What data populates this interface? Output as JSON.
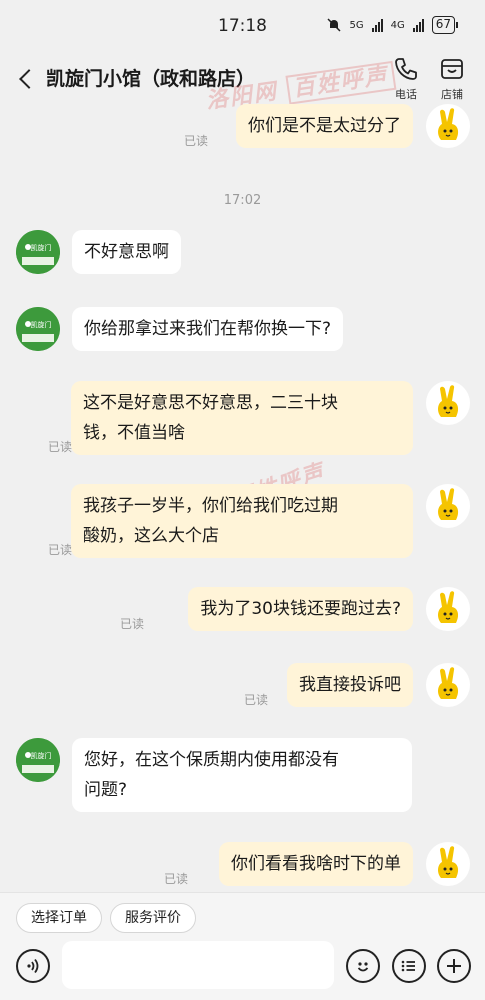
{
  "status_bar": {
    "time": "17:18",
    "net1": "5G",
    "net2": "4G",
    "battery": "67"
  },
  "header": {
    "title": "凯旋门小馆（政和路店）",
    "phone_label": "电话",
    "shop_label": "店铺"
  },
  "watermark": {
    "site": "洛阳网",
    "column": "百姓呼声"
  },
  "timestamp": "17:02",
  "read_label": "已读",
  "shop_logo_text": "凯旋门",
  "messages": [
    {
      "sender": "me",
      "text": "你们是不是太过分了",
      "read": true
    },
    {
      "sender": "shop",
      "text": "不好意思啊"
    },
    {
      "sender": "shop",
      "text": "你给那拿过来我们在帮你换一下?"
    },
    {
      "sender": "me",
      "text_line1": "这不是好意思不好意思，二三十块",
      "text_line2": "钱，不值当啥",
      "read": true
    },
    {
      "sender": "me",
      "text_line1": "我孩子一岁半，你们给我们吃过期",
      "text_line2": "酸奶，这么大个店",
      "read": true
    },
    {
      "sender": "me",
      "text": "我为了30块钱还要跑过去?",
      "read": true
    },
    {
      "sender": "me",
      "text": "我直接投诉吧",
      "read": true
    },
    {
      "sender": "shop",
      "text_line1": "您好，在这个保质期内使用都没有",
      "text_line2": "问题?"
    },
    {
      "sender": "me",
      "text": "你们看看我啥时下的单",
      "read": true
    }
  ],
  "bottom": {
    "chip1": "选择订单",
    "chip2": "服务评价"
  }
}
